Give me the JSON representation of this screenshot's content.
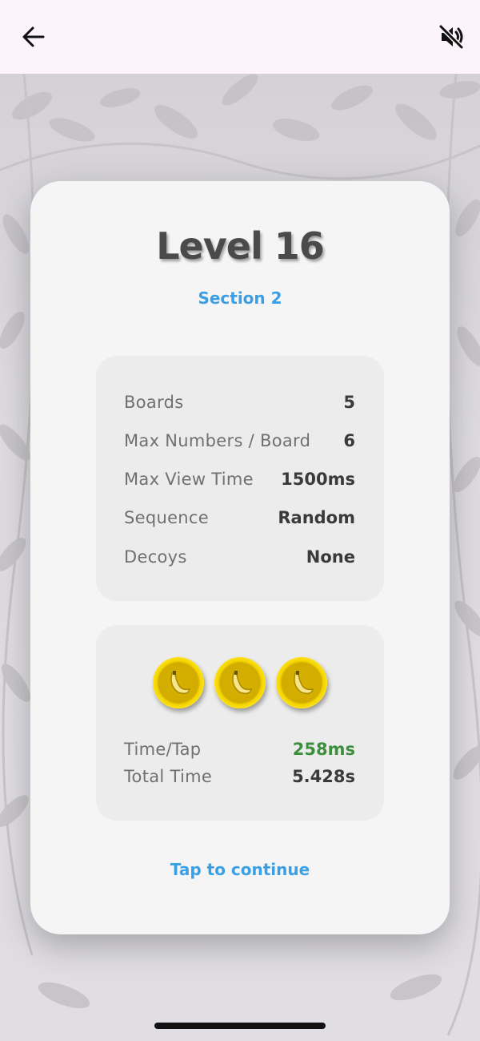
{
  "top_bar": {
    "back_icon": "arrow-left-icon",
    "mute_icon": "volume-off-icon"
  },
  "card": {
    "title": "Level 16",
    "subtitle": "Section 2",
    "stats": [
      {
        "label": "Boards",
        "value": "5"
      },
      {
        "label": "Max Numbers / Board",
        "value": "6"
      },
      {
        "label": "Max View Time",
        "value": "1500ms"
      },
      {
        "label": "Sequence",
        "value": "Random"
      },
      {
        "label": "Decoys",
        "value": "None"
      }
    ],
    "rating": {
      "earned": 3,
      "max": 3,
      "icon": "banana-coin-icon"
    },
    "results": [
      {
        "label": "Time/Tap",
        "value": "258ms",
        "color": "#3d8f3d"
      },
      {
        "label": "Total Time",
        "value": "5.428s"
      }
    ],
    "continue_label": "Tap to continue"
  },
  "colors": {
    "accent": "#3aa0e6",
    "good": "#3d8f3d",
    "coin": "#ffd600"
  }
}
